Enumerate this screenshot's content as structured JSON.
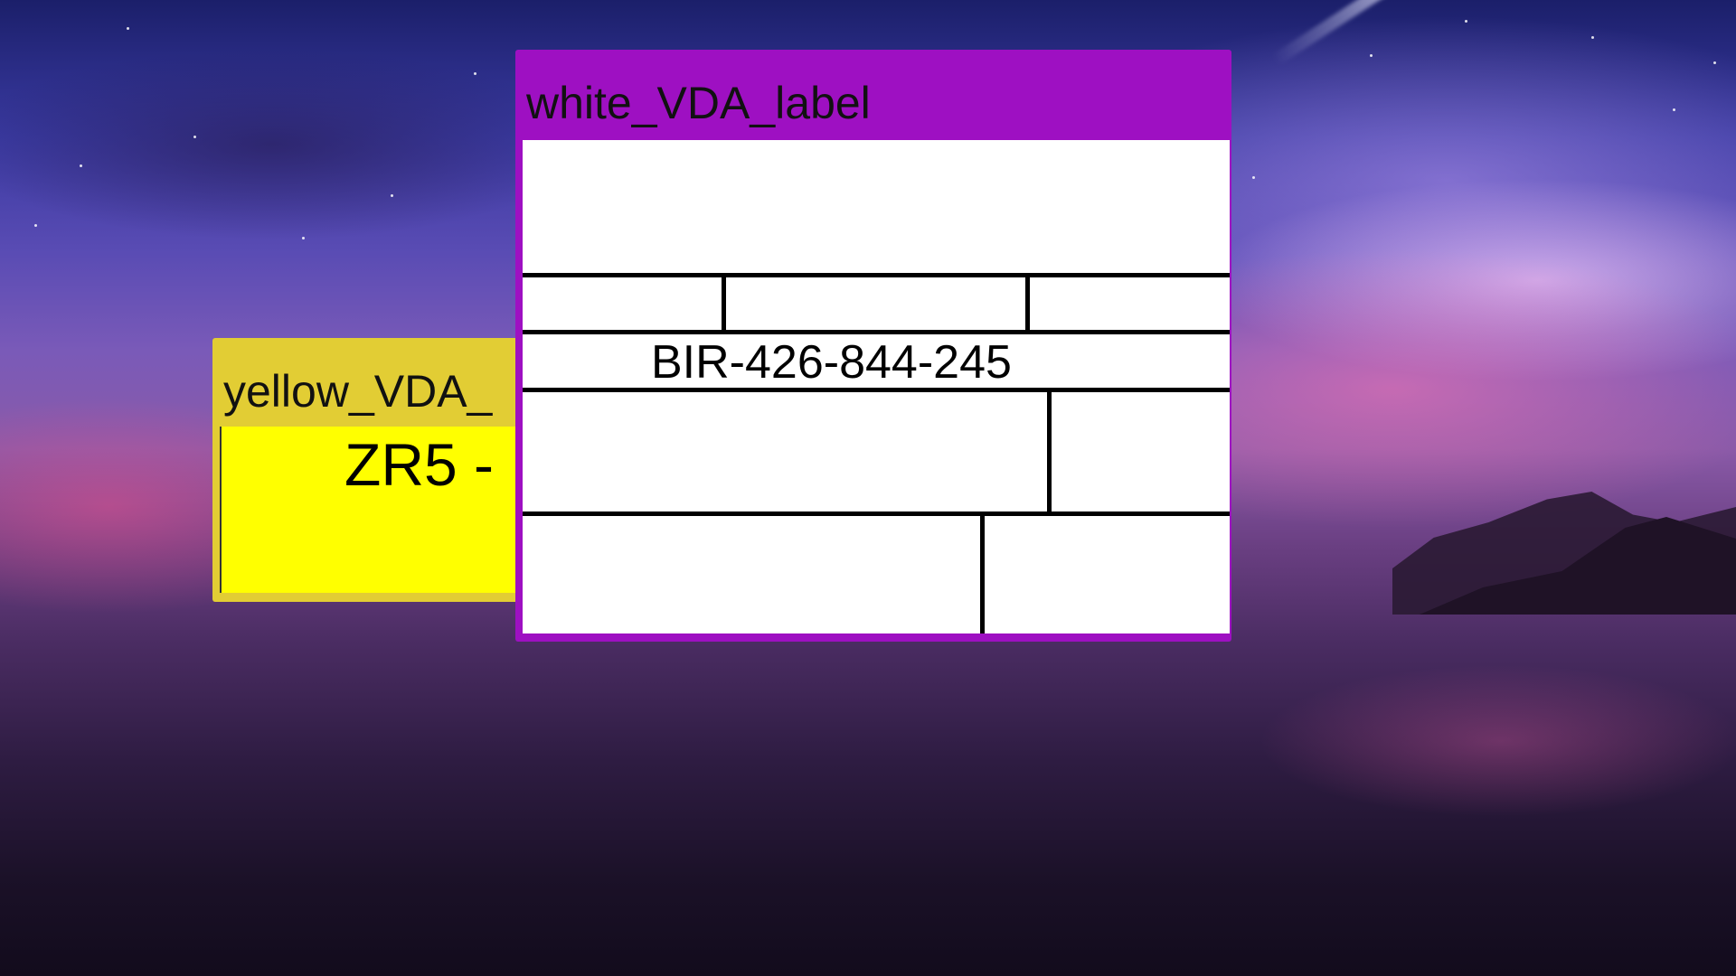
{
  "desktop": {
    "wallpaper": "night-sky-purple-clouds"
  },
  "windows": {
    "yellow": {
      "title": "yellow_VDA_",
      "code": "ZR5 -",
      "title_bar_color": "#e2cd34",
      "body_color": "#ffff00"
    },
    "white": {
      "title": "white_VDA_label",
      "code": "BIR-426-844-245",
      "title_bar_color": "#9e10c2",
      "body_color": "#ffffff"
    }
  }
}
